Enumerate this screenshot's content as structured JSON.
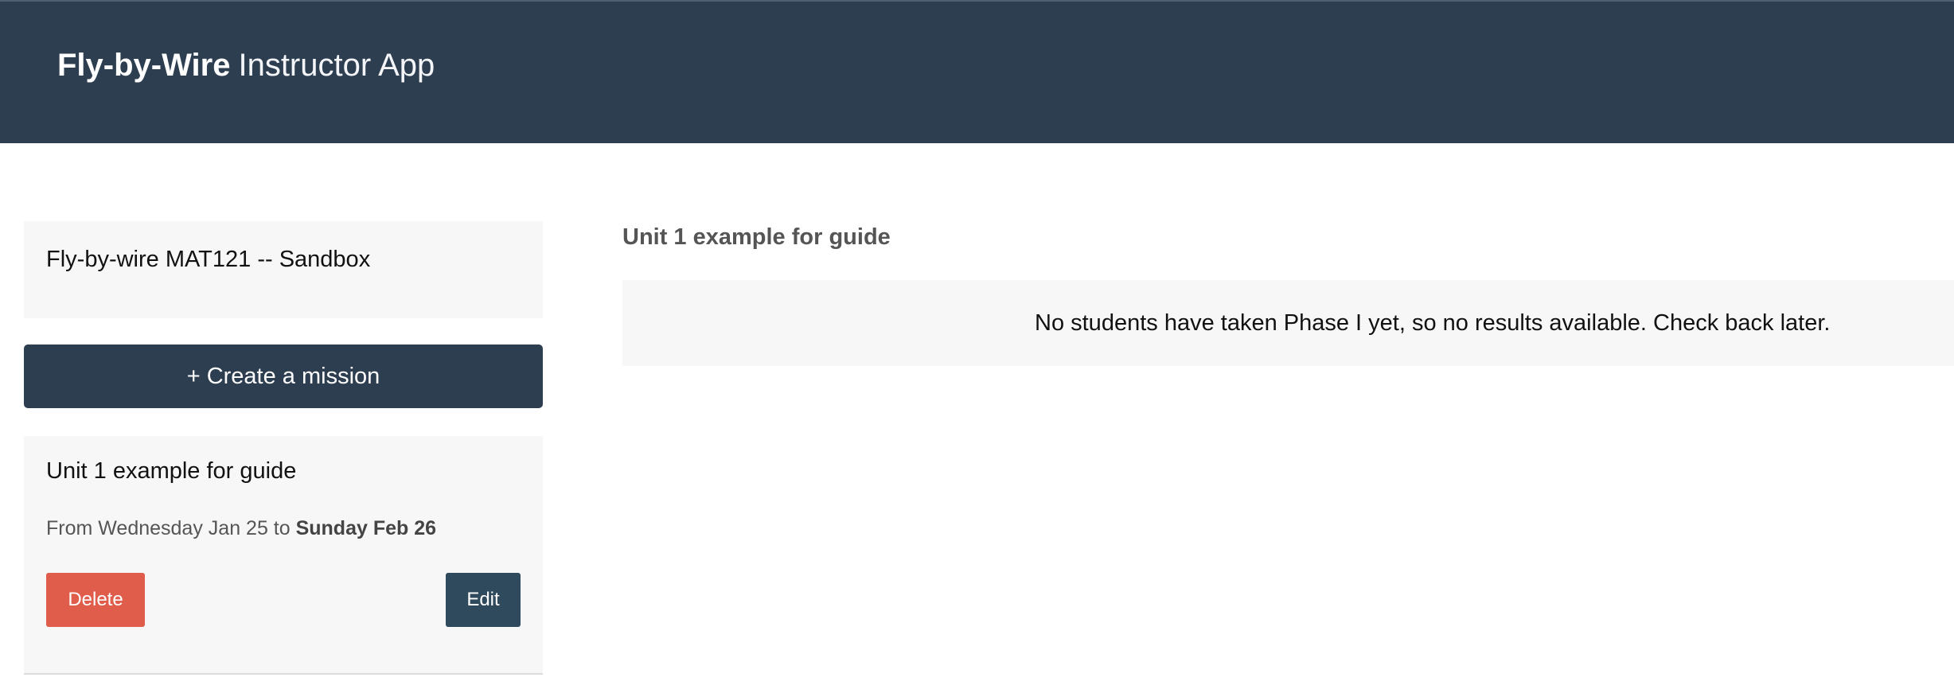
{
  "header": {
    "brand_bold": "Fly-by-Wire",
    "brand_light": "Instructor App",
    "background_color": "#2e3e51"
  },
  "sidebar": {
    "course": {
      "title": "Fly-by-wire MAT121 -- Sandbox"
    },
    "create_mission_label": "+ Create a mission",
    "missions": [
      {
        "title": "Unit 1 example for guide",
        "dates_prefix": "From Wednesday Jan 25 to",
        "dates_end": "Sunday Feb 26",
        "delete_label": "Delete",
        "edit_label": "Edit"
      }
    ]
  },
  "main": {
    "heading": "Unit 1 example for guide",
    "empty_message": "No students have taken Phase I yet, so no results available. Check back later."
  },
  "colors": {
    "primary": "#2e3e51",
    "danger": "#e05c4b",
    "edit": "#2f4a5c",
    "panel": "#f7f7f7"
  }
}
